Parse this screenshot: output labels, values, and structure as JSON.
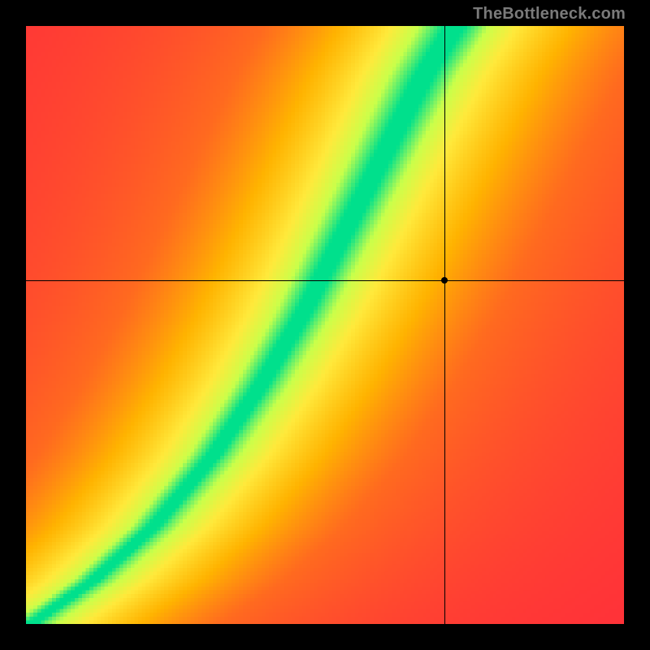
{
  "watermark": {
    "text": "TheBottleneck.com"
  },
  "chart_data": {
    "type": "heatmap",
    "title": "",
    "xlabel": "",
    "ylabel": "",
    "xlim": [
      0,
      1
    ],
    "ylim": [
      0,
      1
    ],
    "grid": false,
    "legend": false,
    "resolution": 160,
    "colormap": {
      "stops": [
        {
          "t": 0.0,
          "color": "#ff2a3c"
        },
        {
          "t": 0.35,
          "color": "#ff6a1f"
        },
        {
          "t": 0.55,
          "color": "#ffb300"
        },
        {
          "t": 0.75,
          "color": "#ffe93b"
        },
        {
          "t": 0.88,
          "color": "#c9ff4a"
        },
        {
          "t": 1.0,
          "color": "#00e08c"
        }
      ]
    },
    "ridge": {
      "comment": "green optimal curve: y as function of x, approximated from image",
      "points": [
        {
          "x": 0.0,
          "y": 0.0
        },
        {
          "x": 0.1,
          "y": 0.07
        },
        {
          "x": 0.2,
          "y": 0.16
        },
        {
          "x": 0.3,
          "y": 0.28
        },
        {
          "x": 0.38,
          "y": 0.4
        },
        {
          "x": 0.45,
          "y": 0.52
        },
        {
          "x": 0.5,
          "y": 0.62
        },
        {
          "x": 0.55,
          "y": 0.72
        },
        {
          "x": 0.6,
          "y": 0.82
        },
        {
          "x": 0.65,
          "y": 0.92
        },
        {
          "x": 0.7,
          "y": 1.0
        }
      ]
    },
    "bandwidth": {
      "comment": "half-width of green band (in x units) as function of y",
      "base": 0.03,
      "top": 0.055
    },
    "crosshair": {
      "comment": "black crosshair marker position in normalized [0,1] coords (origin bottom-left)",
      "x": 0.7,
      "y": 0.575
    }
  }
}
